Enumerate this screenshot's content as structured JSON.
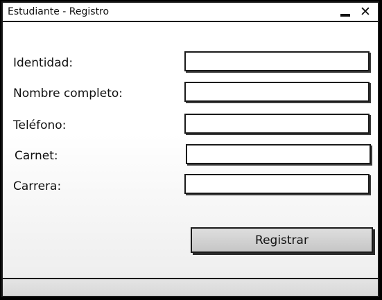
{
  "window": {
    "title": "Estudiante - Registro",
    "minimize_icon": "minimize-icon",
    "close_icon": "close-icon",
    "close_glyph": "✕"
  },
  "form": {
    "fields": [
      {
        "label": "Identidad:",
        "value": ""
      },
      {
        "label": "Nombre completo:",
        "value": ""
      },
      {
        "label": "Teléfono:",
        "value": ""
      },
      {
        "label": "Carnet:",
        "value": ""
      },
      {
        "label": "Carrera:",
        "value": ""
      }
    ],
    "submit_label": "Registrar"
  },
  "status_bar": {
    "text": ""
  }
}
